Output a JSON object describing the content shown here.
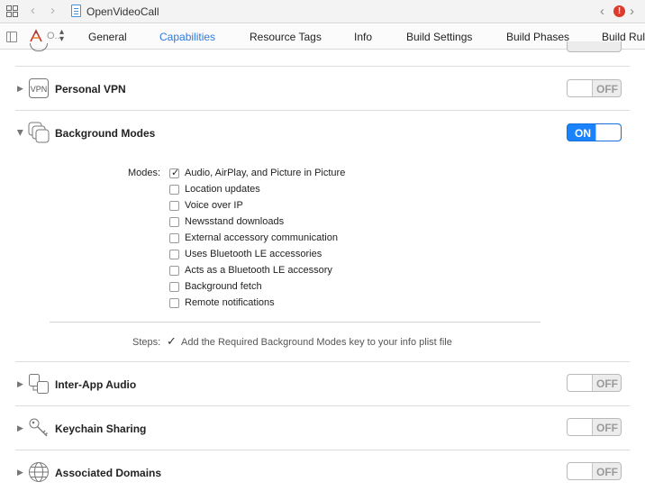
{
  "topbar": {
    "file_title": "OpenVideoCall",
    "back_glyph": "‹",
    "forward_glyph": "›",
    "issue_nav_back": "‹",
    "issue_nav_forward": "›",
    "error_badge": "!"
  },
  "tabbar": {
    "target_label": "O..",
    "tabs": [
      {
        "label": "General",
        "active": false
      },
      {
        "label": "Capabilities",
        "active": true
      },
      {
        "label": "Resource Tags",
        "active": false
      },
      {
        "label": "Info",
        "active": false
      },
      {
        "label": "Build Settings",
        "active": false
      },
      {
        "label": "Build Phases",
        "active": false
      },
      {
        "label": "Build Rule",
        "active": false
      }
    ]
  },
  "capabilities": [
    {
      "title": "Personal VPN",
      "icon": "vpn-icon",
      "icon_text": "VPN",
      "toggle": "OFF"
    },
    {
      "title": "Background Modes",
      "icon": "background-modes-icon",
      "toggle": "ON",
      "expanded": true
    },
    {
      "title": "Inter-App Audio",
      "icon": "inter-app-audio-icon",
      "toggle": "OFF"
    },
    {
      "title": "Keychain Sharing",
      "icon": "keychain-icon",
      "toggle": "OFF"
    },
    {
      "title": "Associated Domains",
      "icon": "globe-icon",
      "toggle": "OFF"
    }
  ],
  "background_modes": {
    "label": "Modes:",
    "modes": [
      {
        "label": "Audio, AirPlay, and Picture in Picture",
        "checked": true
      },
      {
        "label": "Location updates",
        "checked": false
      },
      {
        "label": "Voice over IP",
        "checked": false
      },
      {
        "label": "Newsstand downloads",
        "checked": false
      },
      {
        "label": "External accessory communication",
        "checked": false
      },
      {
        "label": "Uses Bluetooth LE accessories",
        "checked": false
      },
      {
        "label": "Acts as a Bluetooth LE accessory",
        "checked": false
      },
      {
        "label": "Background fetch",
        "checked": false
      },
      {
        "label": "Remote notifications",
        "checked": false
      }
    ],
    "steps_label": "Steps:",
    "steps_text": "Add the Required Background Modes key to your info plist file",
    "check_glyph": "✓"
  },
  "colors": {
    "accent": "#2a7ae2",
    "toggle_on": "#1a82fb",
    "error": "#e0392e"
  }
}
